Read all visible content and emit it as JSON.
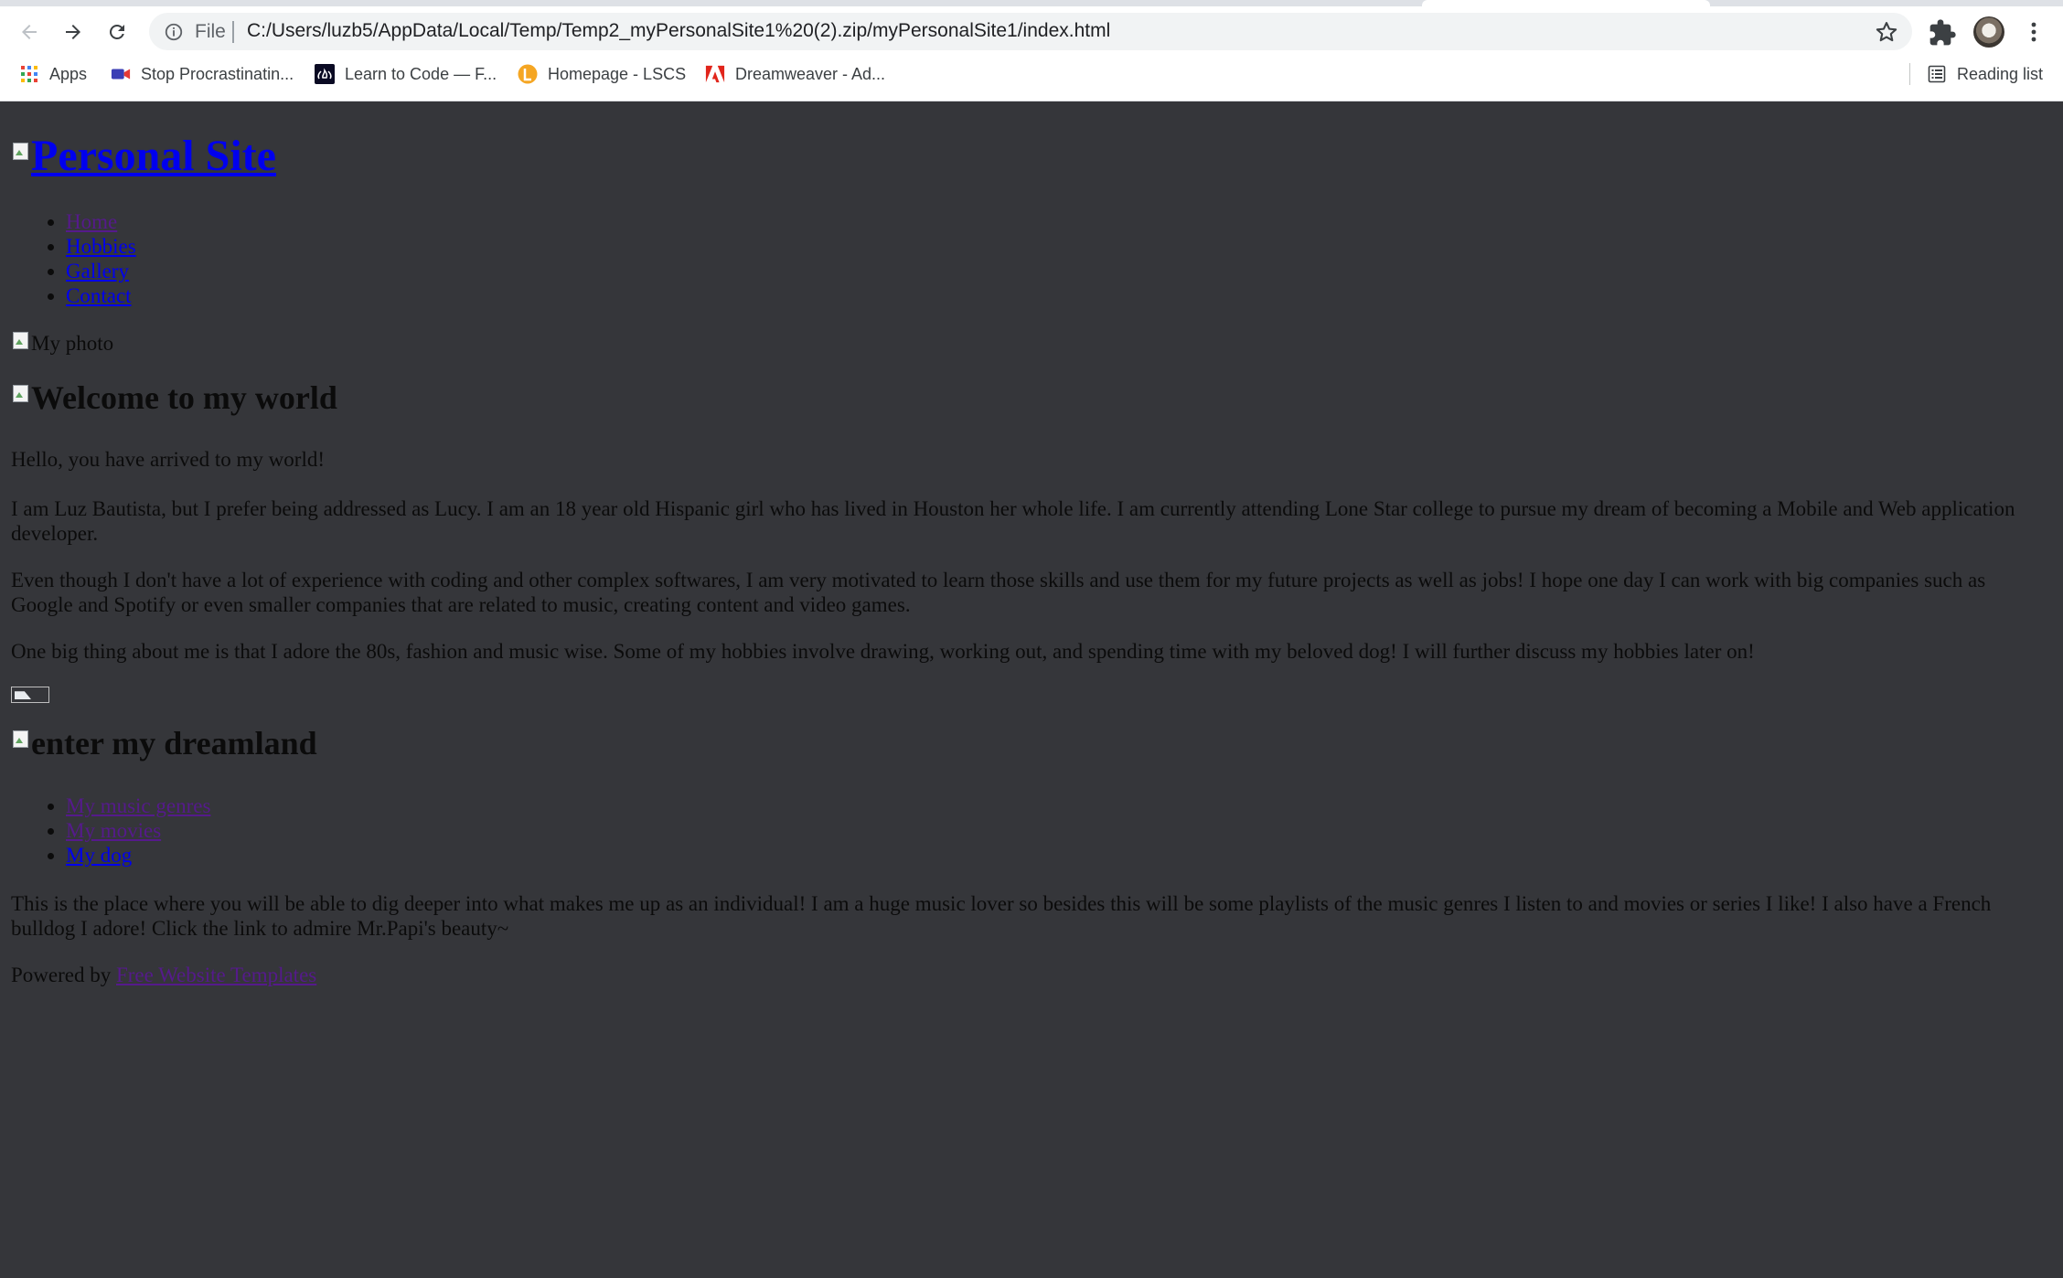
{
  "browser": {
    "address_scheme": "File",
    "url": "C:/Users/luzb5/AppData/Local/Temp/Temp2_myPersonalSite1%20(2).zip/myPersonalSite1/index.html",
    "bookmarks": [
      {
        "label": "Apps",
        "icon": "apps-grid-icon"
      },
      {
        "label": "Stop Procrastinatin...",
        "icon": "video-camera-icon"
      },
      {
        "label": "Learn to Code — F...",
        "icon": "freecodecamp-icon"
      },
      {
        "label": "Homepage - LSCS",
        "icon": "lscs-icon"
      },
      {
        "label": "Dreamweaver - Ad...",
        "icon": "adobe-icon"
      }
    ],
    "reading_list": "Reading list"
  },
  "page": {
    "site_title": "Personal Site",
    "nav": [
      "Home",
      "Hobbies",
      "Gallery",
      "Contact"
    ],
    "photo_alt": "My photo",
    "welcome_heading": "Welcome to my world",
    "intro": "Hello, you have arrived to my world!",
    "para_about": "I am Luz Bautista, but I prefer being addressed as Lucy. I am an 18 year old Hispanic girl who has lived in Houston her whole life. I am currently attending Lone Star college to pursue my dream of becoming a Mobile and Web application developer.",
    "para_goals": "Even though I don't have a lot of experience with coding and other complex softwares, I am very motivated to learn those skills and use them for my future projects as well as jobs! I hope one day I can work with big companies such as Google and Spotify or even smaller companies that are related to music, creating content and video games.",
    "para_hobbies": "One big thing about me is that I adore the 80s, fashion and music wise. Some of my hobbies involve drawing, working out, and spending time with my beloved dog! I will further discuss my hobbies later on!",
    "dream_heading": "enter my dreamland",
    "dream_links": [
      "My music genres",
      "My movies",
      "My dog"
    ],
    "para_dream": "This is the place where you will be able to dig deeper into what makes me up as an individual! I am a huge music lover so besides this will be some playlists of the music genres I listen to and movies or series I like! I also have a French bulldog I adore! Click the link to admire Mr.Papi's beauty~",
    "powered_by": "Powered by",
    "powered_link": "Free Website Templates"
  },
  "colors": {
    "page_background": "#35363a",
    "link_unvisited": "#0000ee",
    "link_visited": "#551a8b"
  }
}
